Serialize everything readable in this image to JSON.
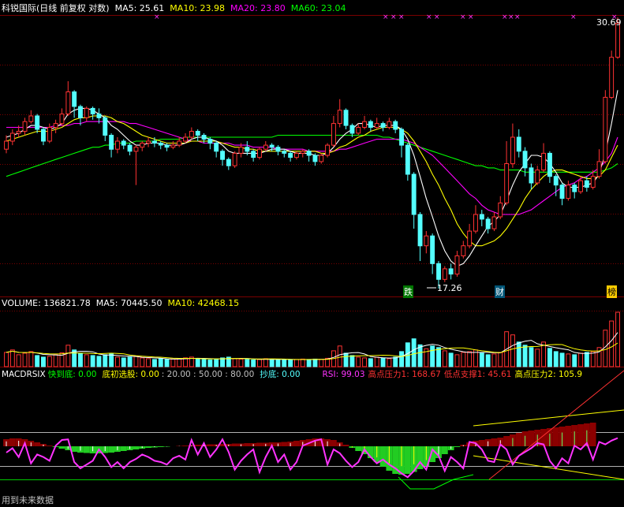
{
  "price_header": {
    "title": "科锐国际(日线 前复权 对数)",
    "ma5": "MA5: 25.61",
    "ma10": "MA10: 23.98",
    "ma20": "MA20: 23.80",
    "ma60": "MA60: 23.04"
  },
  "volume_header": {
    "volume": "VOLUME: 136821.78",
    "ma5": "MA5: 70445.50",
    "ma10": "MA10: 42468.15"
  },
  "indicator_header": {
    "name": "MACDRSIX",
    "fast_bottom": "快到底: 0.00",
    "initial_bottom": "底初选股: 0.00",
    "levels": ": 20.00 : 50.00 : 80.00",
    "copy_bottom": "抄底: 0.00",
    "rsi": "RSI: 99.03",
    "high_pressure1": "高点压力1: 168.67",
    "low_support1": "低点支撑1: 45.61",
    "high_pressure2": "高点压力2: 105.9"
  },
  "annotations": {
    "max_price": "30.69",
    "min_price": "17.26",
    "tag_fall": "跌",
    "tag_wealth": "财",
    "tag_rise": "榜",
    "footer": "用到未来数据"
  },
  "colors": {
    "up": "#ff3232",
    "down": "#54ffff",
    "ma5": "#ffffff",
    "ma10": "#ffff00",
    "ma20": "#ff00ff",
    "ma60": "#00ff00",
    "grid": "#7a0000",
    "rsi": "#ff33ff"
  },
  "chart_data": {
    "type": "candlestick",
    "y_scale": "log",
    "ylim": [
      17.26,
      30.69
    ],
    "candles": [
      [
        23.2,
        23.6,
        23.9,
        23.0
      ],
      [
        23.6,
        24.0,
        24.2,
        23.4
      ],
      [
        24.0,
        24.1,
        24.4,
        23.8
      ],
      [
        24.1,
        24.6,
        24.8,
        23.9
      ],
      [
        24.6,
        24.9,
        25.2,
        24.5
      ],
      [
        24.9,
        24.2,
        25.0,
        24.0
      ],
      [
        24.2,
        23.6,
        24.3,
        23.4
      ],
      [
        23.6,
        24.3,
        24.5,
        23.5
      ],
      [
        24.3,
        24.5,
        24.7,
        24.0
      ],
      [
        24.5,
        25.0,
        25.3,
        24.4
      ],
      [
        25.0,
        26.2,
        26.8,
        24.9
      ],
      [
        26.2,
        25.4,
        26.3,
        24.8
      ],
      [
        25.4,
        24.8,
        25.5,
        24.4
      ],
      [
        24.8,
        25.3,
        25.4,
        24.6
      ],
      [
        25.3,
        25.0,
        25.4,
        24.7
      ],
      [
        25.0,
        24.8,
        25.3,
        24.5
      ],
      [
        24.8,
        23.9,
        24.9,
        23.6
      ],
      [
        23.9,
        23.2,
        24.0,
        22.8
      ],
      [
        23.2,
        23.6,
        23.8,
        23.0
      ],
      [
        23.6,
        23.4,
        23.7,
        23.2
      ],
      [
        23.4,
        23.1,
        23.5,
        22.9
      ],
      [
        23.1,
        23.3,
        23.4,
        21.5
      ],
      [
        23.3,
        23.5,
        23.6,
        23.1
      ],
      [
        23.5,
        23.6,
        23.8,
        23.3
      ],
      [
        23.6,
        23.5,
        23.8,
        23.3
      ],
      [
        23.5,
        23.4,
        23.6,
        23.2
      ],
      [
        23.4,
        23.3,
        23.5,
        23.1
      ],
      [
        23.3,
        23.4,
        23.6,
        23.2
      ],
      [
        23.4,
        23.6,
        23.8,
        23.3
      ],
      [
        23.6,
        23.8,
        24.0,
        23.5
      ],
      [
        23.8,
        24.1,
        24.3,
        23.7
      ],
      [
        24.1,
        23.9,
        24.2,
        23.6
      ],
      [
        23.9,
        23.7,
        24.0,
        23.5
      ],
      [
        23.7,
        23.5,
        23.8,
        23.2
      ],
      [
        23.5,
        23.1,
        23.6,
        22.8
      ],
      [
        23.1,
        22.7,
        23.2,
        22.4
      ],
      [
        22.7,
        22.4,
        22.8,
        22.2
      ],
      [
        22.4,
        23.0,
        23.1,
        22.3
      ],
      [
        23.0,
        23.3,
        23.5,
        22.8
      ],
      [
        23.3,
        23.1,
        23.6,
        22.9
      ],
      [
        23.1,
        22.8,
        23.2,
        22.6
      ],
      [
        22.8,
        23.2,
        23.3,
        22.7
      ],
      [
        23.2,
        23.4,
        23.6,
        23.1
      ],
      [
        23.4,
        23.3,
        23.5,
        23.1
      ],
      [
        23.3,
        23.1,
        23.4,
        22.9
      ],
      [
        23.1,
        23.0,
        23.2,
        22.8
      ],
      [
        23.0,
        22.8,
        23.1,
        22.6
      ],
      [
        22.8,
        23.0,
        23.1,
        22.7
      ],
      [
        23.0,
        23.1,
        23.2,
        22.8
      ],
      [
        23.1,
        22.9,
        23.2,
        22.6
      ],
      [
        22.9,
        22.6,
        23.0,
        22.4
      ],
      [
        22.6,
        22.9,
        23.0,
        22.5
      ],
      [
        22.9,
        23.4,
        23.5,
        22.8
      ],
      [
        23.4,
        24.5,
        24.9,
        23.3
      ],
      [
        24.5,
        25.2,
        25.8,
        24.3
      ],
      [
        25.2,
        24.4,
        25.3,
        24.2
      ],
      [
        24.4,
        24.0,
        24.5,
        23.8
      ],
      [
        24.0,
        24.3,
        24.5,
        23.9
      ],
      [
        24.3,
        24.6,
        24.9,
        24.2
      ],
      [
        24.6,
        24.3,
        24.7,
        24.1
      ],
      [
        24.3,
        24.5,
        24.8,
        24.2
      ],
      [
        24.5,
        24.3,
        24.6,
        24.1
      ],
      [
        24.3,
        24.6,
        24.8,
        24.2
      ],
      [
        24.6,
        24.2,
        24.7,
        24.0
      ],
      [
        24.2,
        23.4,
        24.3,
        22.8
      ],
      [
        23.4,
        22.0,
        23.5,
        21.7
      ],
      [
        22.0,
        20.2,
        22.1,
        19.6
      ],
      [
        20.2,
        18.9,
        20.3,
        18.3
      ],
      [
        18.9,
        19.3,
        19.5,
        18.6
      ],
      [
        19.3,
        18.2,
        19.4,
        17.8
      ],
      [
        18.2,
        17.6,
        18.3,
        17.26
      ],
      [
        17.6,
        18.0,
        18.1,
        17.5
      ],
      [
        18.0,
        17.8,
        18.2,
        17.6
      ],
      [
        17.8,
        18.5,
        18.7,
        17.7
      ],
      [
        18.5,
        18.9,
        19.1,
        18.4
      ],
      [
        18.9,
        19.5,
        19.8,
        18.8
      ],
      [
        19.5,
        20.2,
        20.6,
        19.4
      ],
      [
        20.2,
        20.0,
        20.4,
        19.7
      ],
      [
        20.0,
        19.6,
        20.1,
        19.4
      ],
      [
        19.6,
        20.1,
        20.3,
        19.5
      ],
      [
        20.1,
        20.7,
        21.0,
        20.0
      ],
      [
        20.7,
        22.5,
        23.6,
        20.6
      ],
      [
        22.5,
        23.8,
        24.5,
        22.3
      ],
      [
        23.8,
        23.1,
        24.2,
        22.8
      ],
      [
        23.1,
        22.3,
        23.3,
        21.9
      ],
      [
        22.3,
        21.6,
        22.5,
        21.3
      ],
      [
        21.6,
        22.2,
        22.4,
        21.5
      ],
      [
        22.2,
        23.0,
        23.5,
        22.1
      ],
      [
        23.0,
        21.9,
        23.1,
        21.6
      ],
      [
        21.9,
        21.5,
        22.0,
        21.0
      ],
      [
        21.5,
        20.9,
        21.6,
        20.6
      ],
      [
        20.9,
        21.5,
        21.7,
        20.8
      ],
      [
        21.5,
        21.2,
        21.6,
        20.9
      ],
      [
        21.2,
        21.7,
        21.9,
        21.1
      ],
      [
        21.7,
        21.4,
        21.9,
        21.2
      ],
      [
        21.4,
        21.9,
        22.2,
        21.3
      ],
      [
        21.9,
        22.6,
        23.2,
        21.8
      ],
      [
        22.6,
        25.9,
        26.3,
        22.5
      ],
      [
        25.9,
        28.2,
        28.6,
        25.8
      ],
      [
        28.2,
        30.3,
        30.69,
        28.1
      ]
    ],
    "ma5": [
      23.8,
      23.9,
      24.0,
      24.2,
      24.4,
      24.4,
      24.3,
      24.2,
      24.3,
      24.5,
      25.0,
      25.2,
      25.3,
      25.3,
      25.2,
      25.0,
      24.8,
      24.4,
      24.2,
      23.9,
      23.6,
      23.4,
      23.4,
      23.5,
      23.5,
      23.5,
      23.4,
      23.4,
      23.4,
      23.5,
      23.7,
      23.8,
      23.8,
      23.7,
      23.6,
      23.4,
      23.1,
      23.0,
      23.0,
      23.0,
      23.0,
      23.0,
      23.1,
      23.2,
      23.2,
      23.2,
      23.1,
      23.0,
      23.0,
      23.0,
      22.9,
      22.9,
      23.0,
      23.3,
      23.7,
      24.0,
      24.2,
      24.5,
      24.5,
      24.4,
      24.3,
      24.4,
      24.4,
      24.4,
      24.2,
      23.7,
      22.9,
      21.9,
      20.9,
      20.1,
      19.3,
      18.7,
      18.3,
      18.1,
      18.2,
      18.5,
      18.9,
      19.3,
      19.7,
      19.9,
      20.2,
      20.8,
      21.5,
      22.1,
      22.5,
      22.9,
      22.9,
      22.8,
      22.5,
      22.1,
      21.6,
      21.4,
      21.4,
      21.4,
      21.5,
      21.6,
      22.0,
      23.0,
      24.5,
      26.3
    ],
    "ma10": [
      23.6,
      23.7,
      23.8,
      23.9,
      24.0,
      24.1,
      24.1,
      24.1,
      24.2,
      24.3,
      24.5,
      24.7,
      24.8,
      24.8,
      24.9,
      24.9,
      24.9,
      24.8,
      24.6,
      24.5,
      24.3,
      24.1,
      23.9,
      23.8,
      23.7,
      23.6,
      23.5,
      23.5,
      23.5,
      23.5,
      23.6,
      23.6,
      23.6,
      23.6,
      23.6,
      23.5,
      23.4,
      23.3,
      23.3,
      23.2,
      23.2,
      23.1,
      23.1,
      23.1,
      23.1,
      23.1,
      23.1,
      23.1,
      23.1,
      23.1,
      23.1,
      23.0,
      23.0,
      23.1,
      23.3,
      23.4,
      23.6,
      23.8,
      23.9,
      24.1,
      24.2,
      24.3,
      24.3,
      24.3,
      24.2,
      24.0,
      23.6,
      23.1,
      22.6,
      22.0,
      21.5,
      20.9,
      20.4,
      19.8,
      19.4,
      19.1,
      18.9,
      18.9,
      19.0,
      19.1,
      19.3,
      19.6,
      20.0,
      20.4,
      20.9,
      21.3,
      21.6,
      21.9,
      22.1,
      22.2,
      22.2,
      22.1,
      22.0,
      21.9,
      21.8,
      21.8,
      21.9,
      22.2,
      22.8,
      23.4
    ],
    "ma20": [
      24.3,
      24.3,
      24.3,
      24.3,
      24.3,
      24.3,
      24.3,
      24.3,
      24.4,
      24.4,
      24.4,
      24.5,
      24.5,
      24.6,
      24.6,
      24.6,
      24.6,
      24.6,
      24.6,
      24.6,
      24.5,
      24.5,
      24.4,
      24.3,
      24.2,
      24.1,
      24.0,
      23.9,
      23.8,
      23.7,
      23.6,
      23.6,
      23.5,
      23.5,
      23.5,
      23.5,
      23.5,
      23.4,
      23.4,
      23.4,
      23.3,
      23.3,
      23.3,
      23.3,
      23.2,
      23.2,
      23.2,
      23.2,
      23.2,
      23.1,
      23.1,
      23.1,
      23.1,
      23.1,
      23.2,
      23.2,
      23.3,
      23.4,
      23.5,
      23.6,
      23.7,
      23.7,
      23.7,
      23.7,
      23.7,
      23.6,
      23.5,
      23.3,
      23.1,
      22.9,
      22.6,
      22.3,
      22.0,
      21.7,
      21.4,
      21.1,
      20.9,
      20.6,
      20.4,
      20.3,
      20.2,
      20.2,
      20.2,
      20.2,
      20.3,
      20.4,
      20.6,
      20.8,
      21.0,
      21.2,
      21.4,
      21.5,
      21.6,
      21.8,
      21.9,
      22.1,
      22.3,
      22.6,
      23.0,
      23.8
    ],
    "ma60": [
      21.9,
      22.0,
      22.1,
      22.2,
      22.3,
      22.4,
      22.5,
      22.6,
      22.7,
      22.8,
      22.9,
      23.0,
      23.1,
      23.2,
      23.3,
      23.3,
      23.4,
      23.4,
      23.5,
      23.5,
      23.5,
      23.6,
      23.6,
      23.6,
      23.6,
      23.7,
      23.7,
      23.7,
      23.7,
      23.8,
      23.8,
      23.8,
      23.8,
      23.8,
      23.8,
      23.8,
      23.8,
      23.8,
      23.8,
      23.8,
      23.8,
      23.8,
      23.8,
      23.8,
      23.9,
      23.9,
      23.9,
      23.9,
      23.9,
      23.9,
      23.9,
      23.9,
      23.9,
      23.9,
      23.9,
      23.9,
      23.9,
      23.9,
      23.9,
      23.9,
      23.9,
      23.8,
      23.8,
      23.7,
      23.6,
      23.5,
      23.4,
      23.3,
      23.2,
      23.1,
      23.0,
      22.9,
      22.8,
      22.7,
      22.6,
      22.5,
      22.4,
      22.4,
      22.3,
      22.3,
      22.2,
      22.2,
      22.2,
      22.2,
      22.1,
      22.1,
      22.1,
      22.1,
      22.1,
      22.1,
      22.1,
      22.1,
      22.1,
      22.1,
      22.1,
      22.1,
      22.1,
      22.2,
      22.3,
      22.5
    ],
    "volume": [
      36,
      42,
      30,
      34,
      38,
      28,
      24,
      26,
      30,
      35,
      54,
      42,
      33,
      30,
      28,
      26,
      30,
      32,
      24,
      22,
      24,
      26,
      22,
      20,
      18,
      20,
      18,
      19,
      20,
      22,
      24,
      20,
      18,
      17,
      19,
      22,
      24,
      20,
      19,
      18,
      17,
      18,
      20,
      19,
      18,
      17,
      17,
      18,
      19,
      18,
      19,
      18,
      21,
      40,
      52,
      34,
      28,
      24,
      22,
      20,
      24,
      22,
      20,
      24,
      38,
      60,
      70,
      55,
      45,
      52,
      48,
      40,
      34,
      30,
      36,
      38,
      42,
      34,
      30,
      32,
      36,
      88,
      80,
      62,
      54,
      48,
      44,
      62,
      46,
      38,
      34,
      32,
      30,
      34,
      36,
      38,
      48,
      92,
      115,
      137
    ],
    "rsi": [
      55,
      62,
      48,
      70,
      38,
      52,
      48,
      42,
      66,
      75,
      76,
      40,
      30,
      36,
      42,
      60,
      48,
      32,
      40,
      30,
      40,
      45,
      52,
      48,
      42,
      40,
      36,
      46,
      50,
      44,
      75,
      52,
      70,
      48,
      60,
      76,
      56,
      28,
      42,
      52,
      60,
      24,
      48,
      66,
      40,
      52,
      28,
      40,
      66,
      70,
      74,
      76,
      36,
      60,
      54,
      42,
      32,
      40,
      60,
      48,
      38,
      44,
      36,
      30,
      22,
      16,
      26,
      40,
      28,
      60,
      50,
      26,
      48,
      40,
      30,
      72,
      70,
      60,
      42,
      40,
      68,
      60,
      36,
      50,
      56,
      62,
      70,
      68,
      42,
      30,
      46,
      38,
      66,
      60,
      70,
      44,
      72,
      68,
      74,
      78
    ],
    "macd": [
      18,
      20,
      20,
      18,
      14,
      10,
      6,
      2,
      -2,
      -6,
      -10,
      -14,
      -16,
      -17,
      -18,
      -18,
      -17,
      -16,
      -14,
      -12,
      -10,
      -8,
      -6,
      -4,
      -3,
      -2,
      -1,
      0,
      1,
      2,
      3,
      4,
      4,
      5,
      5,
      6,
      6,
      7,
      7,
      8,
      8,
      9,
      9,
      10,
      10,
      11,
      12,
      14,
      16,
      18,
      20,
      20,
      18,
      16,
      10,
      4,
      -4,
      -12,
      -20,
      -30,
      -40,
      -52,
      -62,
      -70,
      -72,
      -70,
      -65,
      -58,
      -50,
      -40,
      -30,
      -20,
      -10,
      -2,
      4,
      10,
      14,
      16,
      18,
      20,
      22,
      26,
      30,
      34,
      38,
      40,
      42,
      44,
      46,
      48,
      50,
      52,
      54,
      56,
      58,
      60
    ]
  }
}
